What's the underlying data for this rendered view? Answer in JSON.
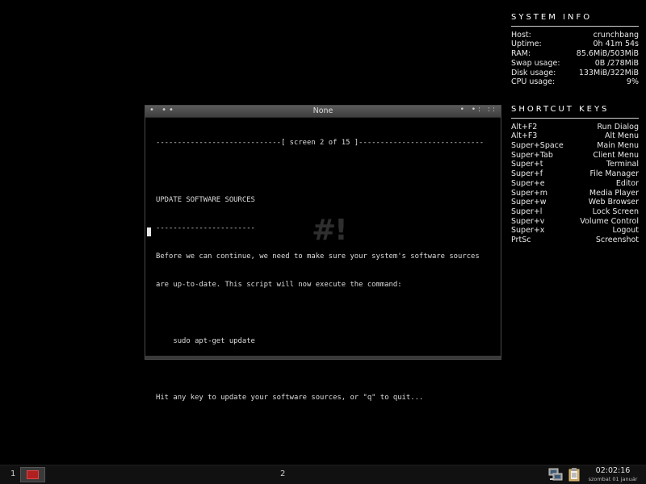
{
  "conky": {
    "system_title": "SYSTEM INFO",
    "system_rows": [
      {
        "label": "Host:",
        "value": "crunchbang"
      },
      {
        "label": "Uptime:",
        "value": "0h 41m 54s"
      },
      {
        "label": "RAM:",
        "value": "85.6MiB/503MiB"
      },
      {
        "label": "Swap usage:",
        "value": "0B /278MiB"
      },
      {
        "label": "Disk usage:",
        "value": "133MiB/322MiB"
      },
      {
        "label": "CPU usage:",
        "value": "9%"
      }
    ],
    "shortcut_title": "SHORTCUT KEYS",
    "shortcut_rows": [
      {
        "label": "Alt+F2",
        "value": "Run Dialog"
      },
      {
        "label": "Alt+F3",
        "value": "Alt Menu"
      },
      {
        "label": "Super+Space",
        "value": "Main Menu"
      },
      {
        "label": "Super+Tab",
        "value": "Client Menu"
      },
      {
        "label": "Super+t",
        "value": "Terminal"
      },
      {
        "label": "Super+f",
        "value": "File Manager"
      },
      {
        "label": "Super+e",
        "value": "Editor"
      },
      {
        "label": "Super+m",
        "value": "Media Player"
      },
      {
        "label": "Super+w",
        "value": "Web Browser"
      },
      {
        "label": "Super+l",
        "value": "Lock Screen"
      },
      {
        "label": "Super+v",
        "value": "Volume Control"
      },
      {
        "label": "Super+x",
        "value": "Logout"
      },
      {
        "label": "PrtSc",
        "value": "Screenshot"
      }
    ]
  },
  "window": {
    "title": "None",
    "left_controls": "• ••",
    "right_controls": "• •: ::",
    "lines": [
      "-----------------------------[ screen 2 of 15 ]-----------------------------",
      "",
      "UPDATE SOFTWARE SOURCES",
      "-----------------------",
      "Before we can continue, we need to make sure your system's software sources",
      "are up-to-date. This script will now execute the command:",
      "",
      "    sudo apt-get update",
      "",
      "Hit any key to update your software sources, or \"q\" to quit..."
    ],
    "logo": "#!"
  },
  "taskbar": {
    "workspace_1": "1",
    "workspace_2": "2",
    "time": "02:02:16",
    "date": "szombat 01 január"
  },
  "colors": {
    "background": "#000000",
    "text": "#e6e6e6",
    "titlebar": "#4a4a4a",
    "taskbar": "#111111",
    "app_icon": "#b02020"
  }
}
